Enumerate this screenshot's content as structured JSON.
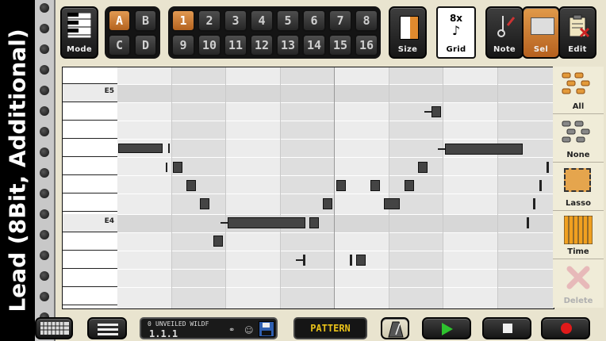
{
  "window_title": "Lead (8Bit, Additional)",
  "toolbar": {
    "mode_label": "Mode",
    "patterns": [
      "A",
      "B",
      "C",
      "D"
    ],
    "pattern_active": "A",
    "steps": [
      "1",
      "2",
      "3",
      "4",
      "5",
      "6",
      "7",
      "8",
      "9",
      "10",
      "11",
      "12",
      "13",
      "14",
      "15",
      "16"
    ],
    "step_active": "1",
    "size_label": "Size",
    "grid_value": "8x",
    "grid_symbol": "♪",
    "grid_label": "Grid",
    "note_label": "Note",
    "sel_label": "Sel",
    "edit_label": "Edit"
  },
  "piano": {
    "labels": {
      "e5": "E5",
      "e4": "E4"
    }
  },
  "side_tools": {
    "all": "All",
    "none": "None",
    "lasso": "Lasso",
    "time": "Time",
    "delete": "Delete"
  },
  "bottom": {
    "song_name": "UNVEILED WILDF",
    "song_index": "0",
    "position": "1.1.1",
    "pattern_label": "PATTERN"
  },
  "colors": {
    "accent": "#d07a30",
    "background": "#e9e4cf",
    "note": "#444444"
  }
}
